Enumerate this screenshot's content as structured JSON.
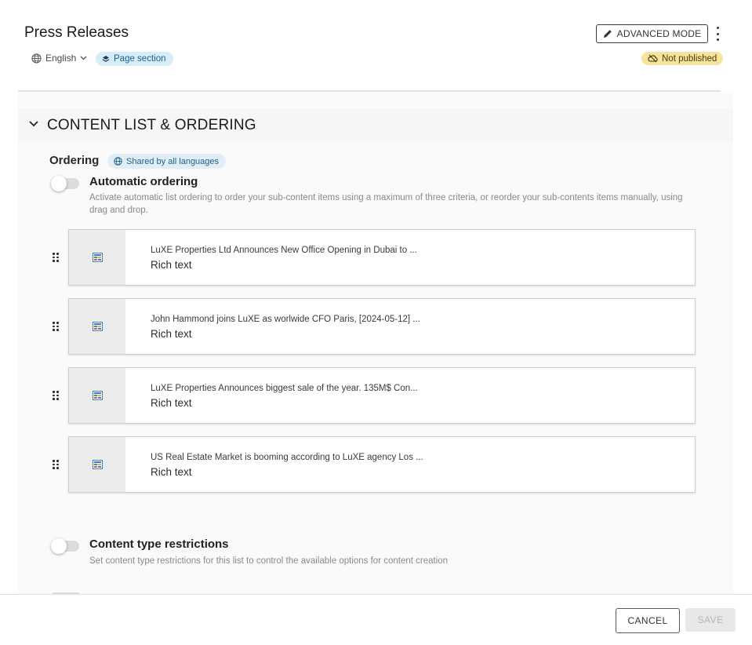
{
  "header": {
    "title": "Press Releases",
    "language": "English",
    "page_section_chip": "Page section",
    "advanced_mode_label": "ADVANCED MODE",
    "status_badge": "Not published"
  },
  "section": {
    "title": "CONTENT LIST & ORDERING",
    "ordering_label": "Ordering",
    "shared_chip": "Shared by all languages",
    "automatic_ordering": {
      "title": "Automatic ordering",
      "description": "Activate automatic list ordering to order your sub-content items using a maximum of three criteria, or reorder your sub-contents items manually, using drag and drop.",
      "enabled": false
    },
    "items": [
      {
        "title": "LuXE Properties Ltd Announces New Office Opening in Dubai to ...",
        "type": "Rich text"
      },
      {
        "title": "John Hammond joins LuXE as worlwide CFO Paris, [2024-05-12] ...",
        "type": "Rich text"
      },
      {
        "title": "LuXE Properties Announces biggest sale of the year. 135M$ Con...",
        "type": "Rich text"
      },
      {
        "title": "US Real Estate Market is booming according to LuXE agency Los ...",
        "type": "Rich text"
      }
    ],
    "content_type_restrictions": {
      "title": "Content type restrictions",
      "description": "Set content type restrictions for this list to control the available options for content creation",
      "enabled": false
    }
  },
  "footer": {
    "cancel_label": "CANCEL",
    "save_label": "SAVE"
  },
  "colors": {
    "chip_blue_bg": "#d6ecf8",
    "chip_blue_text": "#1d5f8a",
    "status_yellow": "#f7e39b"
  }
}
